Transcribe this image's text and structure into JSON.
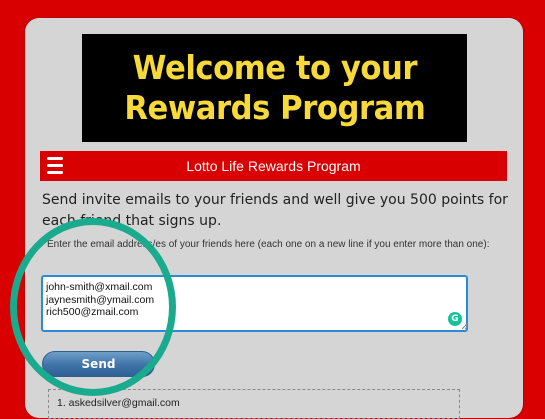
{
  "banner": {
    "title": "Welcome to your\nRewards Program"
  },
  "navbar": {
    "title": "Lotto Life Rewards Program",
    "menu_icon": "hamburger-menu-icon"
  },
  "intro_text": "Send invite emails to your friends and well give you 500 points for each friend that signs up.",
  "help_text": "Enter the email address/es of your friends here (each one on a new line if you enter more than one):",
  "email_box": {
    "lines": [
      "john-smith@xmail.com",
      "jaynesmith@ymail.com",
      "rich500@zmail.com"
    ]
  },
  "send_button": {
    "label": "Send"
  },
  "invite_list": {
    "items": [
      "1. askedsilver@gmail.com"
    ]
  },
  "colors": {
    "background": "#d80000",
    "banner_text": "#f8d93a",
    "highlight": "#1aaa8e",
    "button": "#3f73a8"
  }
}
